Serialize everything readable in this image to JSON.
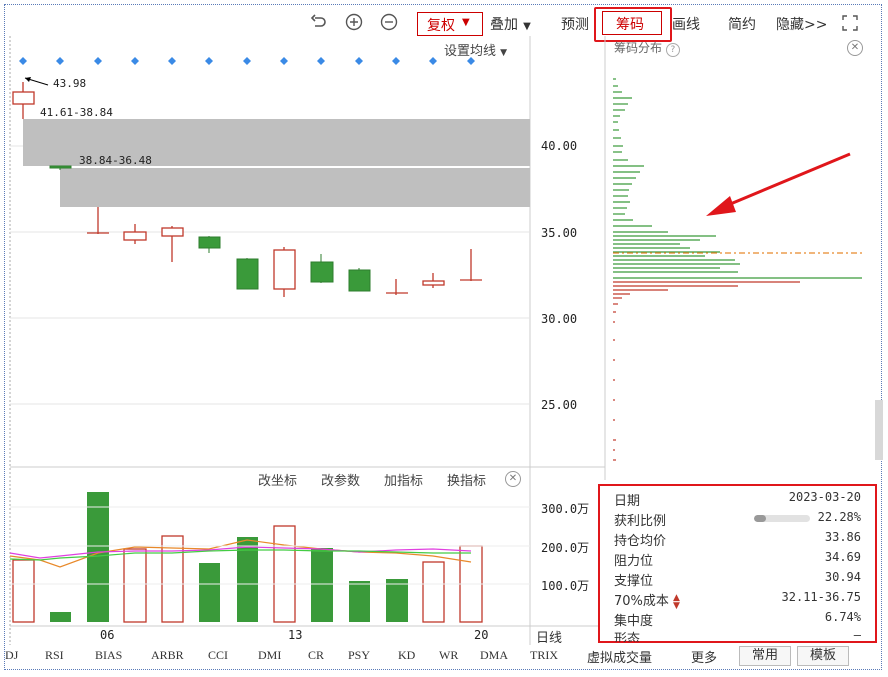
{
  "toolbar": {
    "fq_label": "复权",
    "overlay_label": "叠加",
    "predict_label": "预测",
    "chip_label": "筹码",
    "draw_label": "画线",
    "simple_label": "简约",
    "hide_label": "隐藏>>"
  },
  "main_chart": {
    "set_ma_label": "设置均线",
    "high_label": "43.98",
    "gap1_label": "41.61-38.84",
    "gap2_label": "38.84-36.48",
    "y_ticks": [
      "40.00",
      "35.00",
      "30.00",
      "25.00"
    ]
  },
  "chip_panel": {
    "title": "筹码分布",
    "help": "?"
  },
  "indicator_toolbar": {
    "change_axis": "改坐标",
    "change_param": "改参数",
    "add_indicator": "加指标",
    "swap_indicator": "换指标"
  },
  "volume_chart": {
    "y_ticks": [
      "300.0万",
      "200.0万",
      "100.0万"
    ],
    "x_ticks": [
      "06",
      "13",
      "20"
    ],
    "period": "日线"
  },
  "info": {
    "date_label": "日期",
    "date_value": "2023-03-20",
    "profit_label": "获利比例",
    "profit_value": "22.28%",
    "profit_ratio": 0.2228,
    "avg_label": "持仓均价",
    "avg_value": "33.86",
    "resist_label": "阻力位",
    "resist_value": "34.69",
    "support_label": "支撑位",
    "support_value": "30.94",
    "cost_label": "70%成本",
    "cost_value": "32.11-36.75",
    "conc_label": "集中度",
    "conc_value": "6.74%",
    "shape_label": "形态",
    "shape_value": "—"
  },
  "tabs": [
    "DJ",
    "RSI",
    "BIAS",
    "ARBR",
    "CCI",
    "DMI",
    "CR",
    "PSY",
    "KD",
    "WR",
    "DMA",
    "TRIX",
    "虚拟成交量",
    "更多"
  ],
  "tab_buttons": [
    "常用",
    "模板"
  ],
  "colors": {
    "up": "#c0392b",
    "down": "#3a9a3a",
    "highlight": "#e0161b",
    "gap": "#bfbfbf"
  }
}
